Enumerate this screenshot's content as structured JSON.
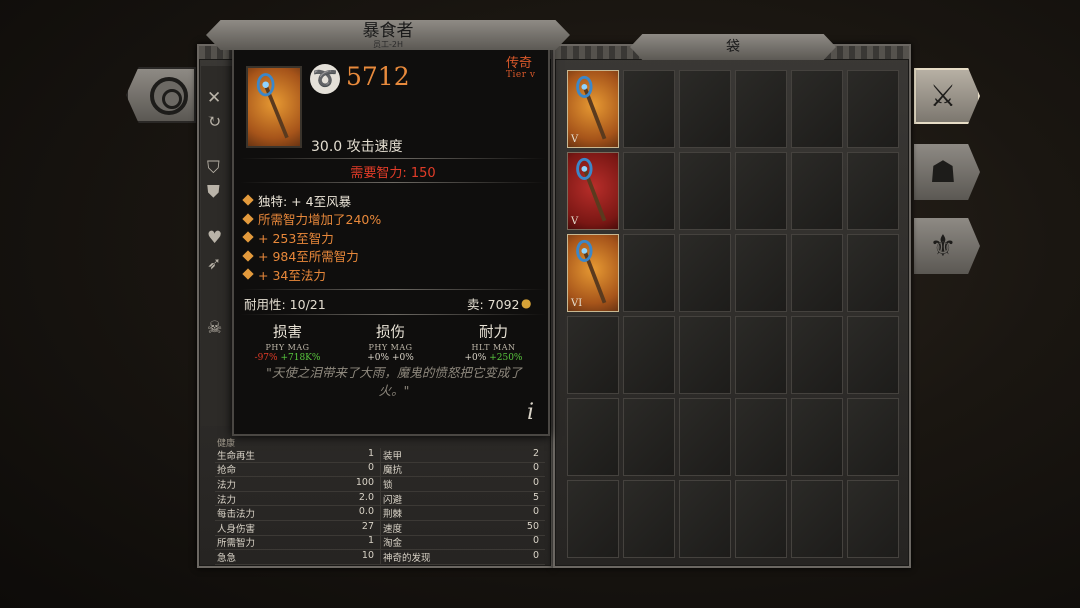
{
  "tooltip": {
    "title": "暴食者",
    "subtitle": "员工-2H",
    "value": "5712",
    "rarity": "传奇",
    "tier": "Tier v",
    "attack_speed": "30.0 攻击速度",
    "requirement": "需要智力: 150",
    "mods": [
      {
        "text": "独特: + 4至风暴",
        "color": "white"
      },
      {
        "text": "所需智力增加了240%",
        "color": "orange"
      },
      {
        "text": "+ 253至智力",
        "color": "orange"
      },
      {
        "text": "+ 984至所需智力",
        "color": "orange"
      },
      {
        "text": "+ 34至法力",
        "color": "orange"
      }
    ],
    "durability": "耐用性: 10/21",
    "sell": "卖: 7092",
    "columns": [
      {
        "title": "损害",
        "sub": "PHY  MAG",
        "v1": "-97%",
        "v2": "+718K%",
        "c1": "neg",
        "c2": "pos"
      },
      {
        "title": "损伤",
        "sub": "PHY  MAG",
        "v1": "+0%",
        "v2": "+0%",
        "c1": "neu",
        "c2": "neu"
      },
      {
        "title": "耐力",
        "sub": "HLT  MAN",
        "v1": "+0%",
        "v2": "+250%",
        "c1": "neu",
        "c2": "pos"
      }
    ],
    "quote": "\"天使之泪带来了大雨，魔鬼的愤怒把它变成了火。\"",
    "info": "i"
  },
  "bag": {
    "title": "袋",
    "items": [
      {
        "tier": "V",
        "style": "gold"
      },
      {
        "tier": "V",
        "style": "red"
      },
      {
        "tier": "VI",
        "style": "gold"
      }
    ]
  },
  "stats": {
    "header": "健康",
    "rows": [
      [
        "生命再生",
        "1",
        "装甲",
        "2"
      ],
      [
        "抢命",
        "0",
        "魔抗",
        "0"
      ],
      [
        "法力",
        "100",
        "锁",
        "0"
      ],
      [
        "法力",
        "2.0",
        "闪避",
        "5"
      ],
      [
        "每击法力",
        "0.0",
        "荆棘",
        "0"
      ],
      [
        "人身伤害",
        "27",
        "速度",
        "50"
      ],
      [
        "所需智力",
        "1",
        "淘金",
        "0"
      ],
      [
        "急急",
        "10",
        "神奇的发现",
        "0"
      ]
    ]
  },
  "icons": {
    "left_button": "ring-icon",
    "right_buttons": [
      "axe-icon",
      "beast-icon",
      "wings-icon"
    ]
  }
}
